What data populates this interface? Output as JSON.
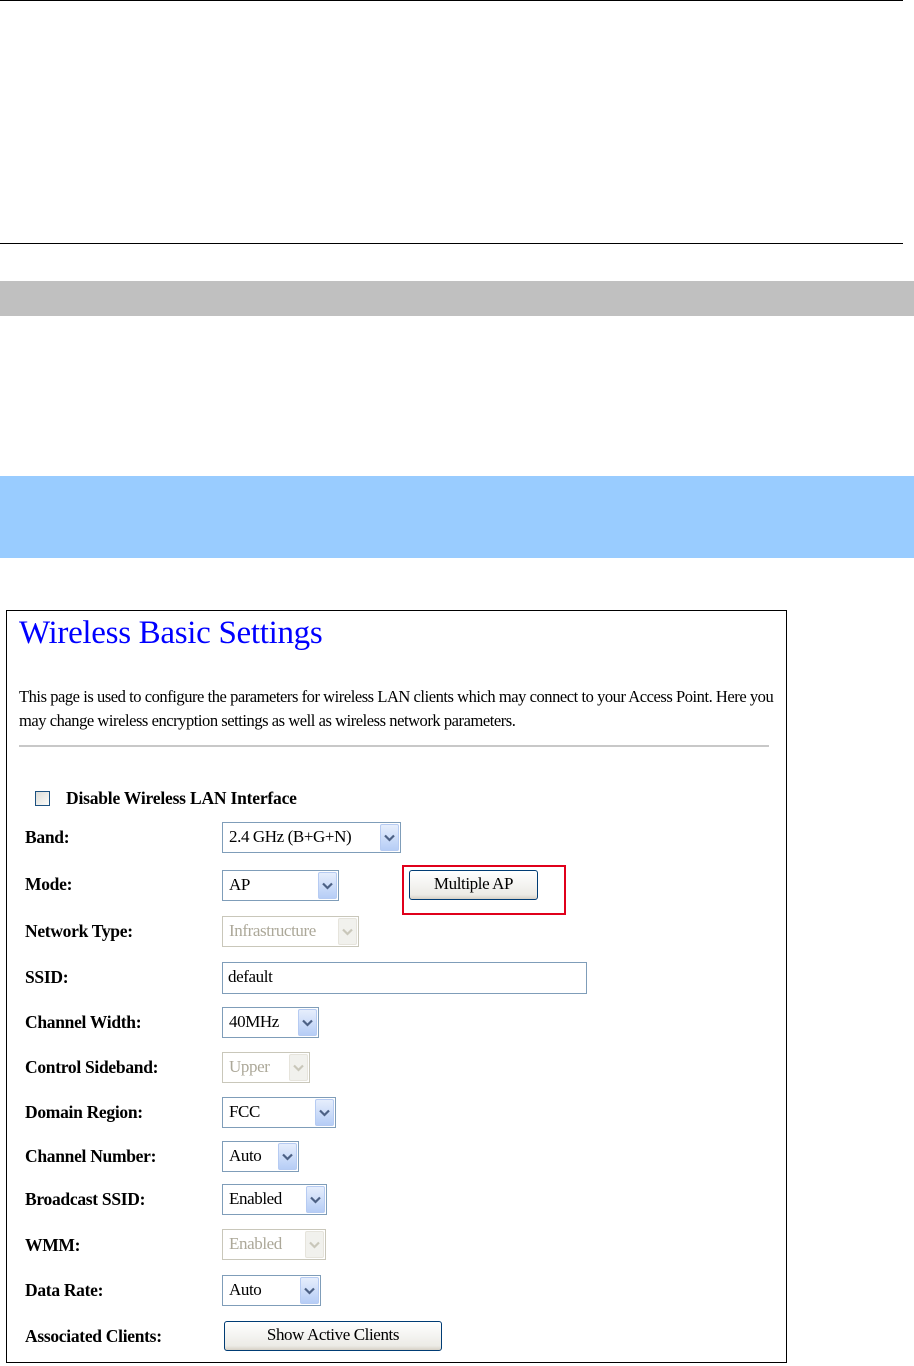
{
  "page": {
    "title": "Wireless Basic Settings",
    "description": "This page is used to configure the parameters for wireless LAN clients which may connect to your Access Point. Here you may change wireless encryption settings as well as wireless network parameters."
  },
  "disable_interface": {
    "label": "Disable Wireless LAN Interface",
    "checked": false
  },
  "fields": {
    "band": {
      "label": "Band:",
      "value": "2.4 GHz (B+G+N)"
    },
    "mode": {
      "label": "Mode:",
      "value": "AP"
    },
    "multiple_ap": {
      "label": "Multiple AP"
    },
    "network_type": {
      "label": "Network Type:",
      "value": "Infrastructure",
      "disabled": true
    },
    "ssid": {
      "label": "SSID:",
      "value": "default"
    },
    "channel_width": {
      "label": "Channel Width:",
      "value": "40MHz"
    },
    "control_sideband": {
      "label": "Control Sideband:",
      "value": "Upper",
      "disabled": true
    },
    "domain_region": {
      "label": "Domain Region:",
      "value": "FCC"
    },
    "channel_number": {
      "label": "Channel Number:",
      "value": "Auto"
    },
    "broadcast_ssid": {
      "label": "Broadcast SSID:",
      "value": "Enabled"
    },
    "wmm": {
      "label": "WMM:",
      "value": "Enabled",
      "disabled": true
    },
    "data_rate": {
      "label": "Data Rate:",
      "value": "Auto"
    },
    "associated_clients": {
      "label": "Associated Clients:",
      "button": "Show Active Clients"
    }
  },
  "colors": {
    "title": "#0000ff",
    "highlight_box": "#e0001b",
    "gray_bar": "#c0c0c0",
    "blue_bar": "#99ccff"
  }
}
